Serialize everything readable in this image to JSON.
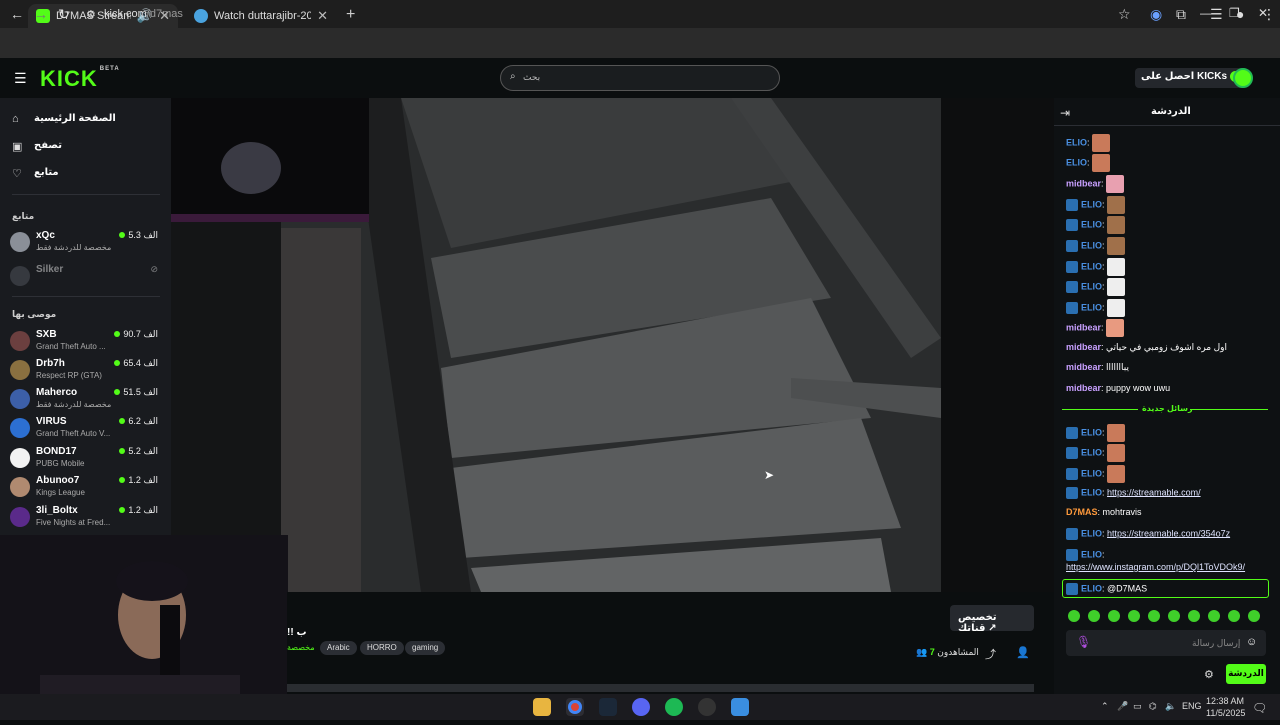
{
  "browser": {
    "tabs": [
      {
        "title": "D7MAS Stream - Watch Live",
        "favicon_color": "#53fc18"
      },
      {
        "title": "Watch duttarajibr-20250304_2...",
        "favicon_color": "#4aa3df"
      }
    ],
    "new_tab": "+",
    "url_host": "kick.com",
    "url_path": "/d7mas"
  },
  "header": {
    "logo": "KICK",
    "logo_badge": "BETA",
    "search_placeholder": "بحث",
    "get_kicks_label": "احصل على KICKs"
  },
  "sidebar": {
    "nav": [
      {
        "label": "الصفحة الرئيسية",
        "icon": "home-icon"
      },
      {
        "label": "تصفح",
        "icon": "browse-icon"
      },
      {
        "label": "متابع",
        "icon": "heart-icon"
      }
    ],
    "following_title": "متابع",
    "following": [
      {
        "name": "xQc",
        "category": "مخصصة للدردشة فقط",
        "viewers": "5.3 الف",
        "avatar_color": "#8a8f98"
      },
      {
        "name": "Silker",
        "category": "",
        "viewers": "",
        "avatar_color": "#5a5e66"
      }
    ],
    "recommended_title": "موصى بها",
    "recommended": [
      {
        "name": "SXB",
        "category": "Grand Theft Auto ...",
        "viewers": "90.7 الف",
        "avatar_color": "#6b3f3f"
      },
      {
        "name": "Drb7h",
        "category": "Respect RP (GTA)",
        "viewers": "65.4 الف",
        "avatar_color": "#8a7040"
      },
      {
        "name": "Maherco",
        "category": "مخصصة للدردشة فقط",
        "viewers": "51.5 الف",
        "avatar_color": "#3c5fa8"
      },
      {
        "name": "VIRUS",
        "category": "Grand Theft Auto V...",
        "viewers": "6.2 الف",
        "avatar_color": "#2c6fd1"
      },
      {
        "name": "BOND17",
        "category": "PUBG Mobile",
        "viewers": "5.2 الف",
        "avatar_color": "#f2f2f2"
      },
      {
        "name": "Abunoo7",
        "category": "Kings League",
        "viewers": "1.2 الف",
        "avatar_color": "#b08a70"
      },
      {
        "name": "3li_Boltx",
        "category": "Five Nights at Fred...",
        "viewers": "1.2 الف",
        "avatar_color": "#5a2a8a"
      }
    ]
  },
  "stream_info": {
    "title_fragment": "!! ب",
    "category_fragment": "مخصصة",
    "tags": [
      "Arabic",
      "HORRO",
      "gaming"
    ],
    "viewers_label": "المشاهدون",
    "viewers_count": "7",
    "customize_label": "تخصيص قناتك"
  },
  "chat": {
    "title": "الدردشة",
    "new_messages_label": "رسائل جديدة",
    "messages": [
      {
        "user": "ELIO",
        "text": "",
        "emote": "#c97a5a",
        "badge": false
      },
      {
        "user": "ELIO",
        "text": "",
        "emote": "#c97a5a",
        "badge": false
      },
      {
        "user": "midbear",
        "text": "",
        "emote": "#e8a0b0",
        "badge": false
      },
      {
        "user": "ELIO",
        "text": "",
        "emote": "#a0704a",
        "badge": true
      },
      {
        "user": "ELIO",
        "text": "",
        "emote": "#a0704a",
        "badge": true
      },
      {
        "user": "ELIO",
        "text": "",
        "emote": "#a0704a",
        "badge": true
      },
      {
        "user": "ELIO",
        "text": "",
        "emote": "#eeeeee",
        "badge": true
      },
      {
        "user": "ELIO",
        "text": "",
        "emote": "#eeeeee",
        "badge": true
      },
      {
        "user": "ELIO",
        "text": "",
        "emote": "#eeeeee",
        "badge": true
      },
      {
        "user": "midbear",
        "text": "",
        "emote": "#e89a80",
        "badge": false
      },
      {
        "user": "midbear",
        "text": "اول مره اشوف زومبي في حياتي",
        "emote": "",
        "badge": false
      },
      {
        "user": "midbear",
        "text": "يبااااااا",
        "emote": "",
        "badge": false
      },
      {
        "user": "midbear",
        "text": "puppy wow uwu",
        "emote": "",
        "badge": false
      }
    ],
    "new_messages": [
      {
        "user": "ELIO",
        "text": "",
        "emote": "#c97a5a",
        "badge": true
      },
      {
        "user": "ELIO",
        "text": "",
        "emote": "#c97a5a",
        "badge": true
      },
      {
        "user": "ELIO",
        "text": "",
        "emote": "#c97a5a",
        "badge": true
      },
      {
        "user": "ELIO",
        "link": "https://streamable.com/",
        "badge": true
      },
      {
        "user": "D7MAS",
        "text": "mohtravis",
        "badge": false
      },
      {
        "user": "ELIO",
        "link": "https://streamable.com/354o7z",
        "badge": true
      },
      {
        "user": "ELIO",
        "link": "https://www.instagram.com/p/DQl1ToVDOk9/",
        "badge": true
      },
      {
        "user": "ELIO",
        "text": "@D7MAS",
        "badge": true
      }
    ],
    "input_placeholder": "إرسال رسالة",
    "send_label": "الدردشة"
  },
  "taskbar": {
    "lang": "ENG",
    "time": "12:38 AM",
    "date": "11/5/2025"
  },
  "colors": {
    "accent": "#53fc18",
    "elio": "#4a90e2",
    "midbear": "#c8a0ff",
    "d7mas": "#ff9a3c"
  }
}
